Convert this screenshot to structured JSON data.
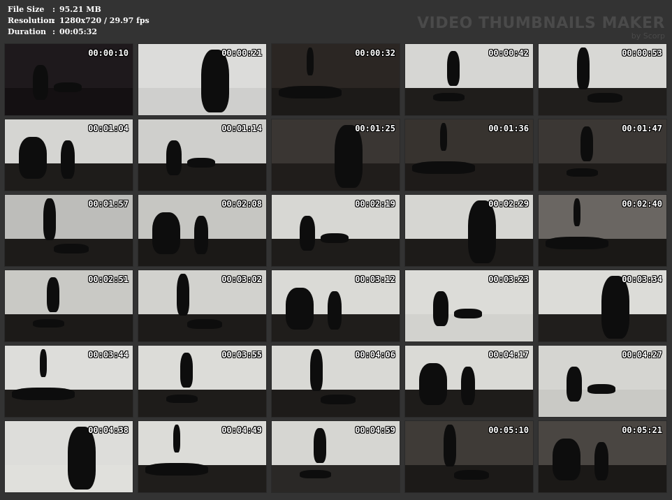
{
  "info": {
    "rows": [
      {
        "label": "File Size",
        "sep": ":",
        "value": "95.21 MB"
      },
      {
        "label": "Resolution",
        "sep": ":",
        "value": "1280x720 / 29.97 fps"
      },
      {
        "label": "Duration",
        "sep": ":",
        "value": "00:05:32"
      }
    ]
  },
  "brand": {
    "title": "VIDEO THUMBNAILS MAKER",
    "subtitle": "by Scorp"
  },
  "thumbnails": [
    {
      "time": "00:00:10",
      "wall": "#1e191c",
      "floor": "#141012"
    },
    {
      "time": "00:00:21",
      "wall": "#dcdcda",
      "floor": "#cfcfcd"
    },
    {
      "time": "00:00:32",
      "wall": "#2b2623",
      "floor": "#1c1a18"
    },
    {
      "time": "00:00:42",
      "wall": "#d6d6d3",
      "floor": "#1f1d1b"
    },
    {
      "time": "00:00:53",
      "wall": "#d8d8d5",
      "floor": "#201e1c"
    },
    {
      "time": "00:01:04",
      "wall": "#d5d5d2",
      "floor": "#1e1c1a"
    },
    {
      "time": "00:01:14",
      "wall": "#cfcfcc",
      "floor": "#1c1a18"
    },
    {
      "time": "00:01:25",
      "wall": "#3a3633",
      "floor": "#201d1b"
    },
    {
      "time": "00:01:36",
      "wall": "#37332f",
      "floor": "#1e1b19"
    },
    {
      "time": "00:01:47",
      "wall": "#3b3734",
      "floor": "#1f1c1a"
    },
    {
      "time": "00:01:57",
      "wall": "#bdbdba",
      "floor": "#1d1b19"
    },
    {
      "time": "00:02:08",
      "wall": "#c6c6c2",
      "floor": "#1b1917"
    },
    {
      "time": "00:02:19",
      "wall": "#d7d7d3",
      "floor": "#1e1c1a"
    },
    {
      "time": "00:02:29",
      "wall": "#d6d6d2",
      "floor": "#1d1b19"
    },
    {
      "time": "00:02:40",
      "wall": "#6a6662",
      "floor": "#1a1816"
    },
    {
      "time": "00:02:51",
      "wall": "#c9c9c5",
      "floor": "#1c1a18"
    },
    {
      "time": "00:03:02",
      "wall": "#d2d2ce",
      "floor": "#1d1b19"
    },
    {
      "time": "00:03:12",
      "wall": "#dadad6",
      "floor": "#1f1d1b"
    },
    {
      "time": "00:03:23",
      "wall": "#dcdcd8",
      "floor": "#d2d2ce"
    },
    {
      "time": "00:03:34",
      "wall": "#dcdcd8",
      "floor": "#201e1c"
    },
    {
      "time": "00:03:44",
      "wall": "#dddddA",
      "floor": "#1f1d1b"
    },
    {
      "time": "00:03:55",
      "wall": "#dcdcd8",
      "floor": "#1e1c1a"
    },
    {
      "time": "00:04:06",
      "wall": "#d9d9d5",
      "floor": "#1d1b19"
    },
    {
      "time": "00:04:17",
      "wall": "#dadad6",
      "floor": "#1e1c1a"
    },
    {
      "time": "00:04:27",
      "wall": "#d5d5d1",
      "floor": "#c9c9c5"
    },
    {
      "time": "00:04:38",
      "wall": "#dddddA",
      "floor": "#e0e0dc"
    },
    {
      "time": "00:04:49",
      "wall": "#dcdcd8",
      "floor": "#1f1d1b"
    },
    {
      "time": "00:04:59",
      "wall": "#d6d6d2",
      "floor": "#2a2826"
    },
    {
      "time": "00:05:10",
      "wall": "#3f3b37",
      "floor": "#1c1a18"
    },
    {
      "time": "00:05:21",
      "wall": "#4a4642",
      "floor": "#1b1917"
    }
  ]
}
